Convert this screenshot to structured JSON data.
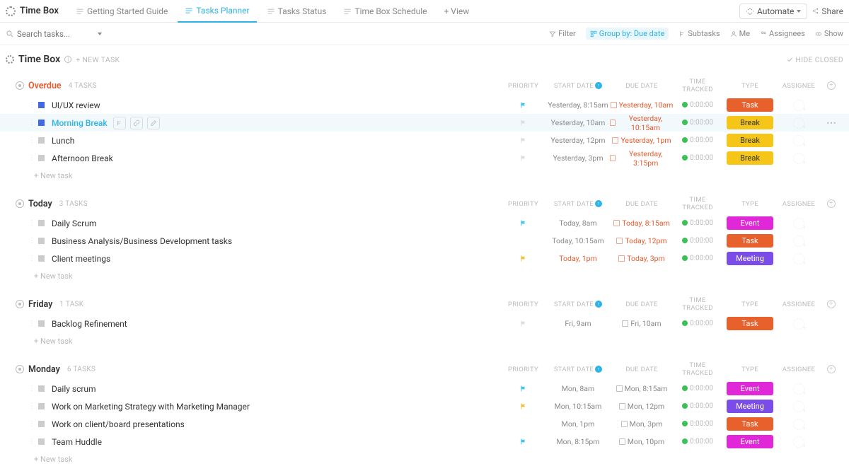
{
  "topbar": {
    "title": "Time Box",
    "tabs": [
      {
        "label": "Getting Started Guide"
      },
      {
        "label": "Tasks Planner",
        "active": true
      },
      {
        "label": "Tasks Status"
      },
      {
        "label": "Time Box Schedule"
      }
    ],
    "add_view": "+ View",
    "automate": "Automate",
    "share": "Share"
  },
  "filterbar": {
    "search_placeholder": "Search tasks...",
    "filter": "Filter",
    "group_by": "Group by: Due date",
    "subtasks": "Subtasks",
    "me": "Me",
    "assignees": "Assignees",
    "show": "Show"
  },
  "list_header": {
    "title": "Time Box",
    "new_task": "+ NEW TASK",
    "hide_closed": "HIDE CLOSED"
  },
  "column_headers": {
    "priority": "PRIORITY",
    "start_date": "START DATE",
    "due_date": "DUE DATE",
    "time_tracked": "TIME TRACKED",
    "type": "TYPE",
    "assignee": "ASSIGNEE"
  },
  "groups": [
    {
      "name": "Overdue",
      "overdue": true,
      "count": "4 TASKS",
      "tasks": [
        {
          "name": "UI/UX review",
          "status": "blue",
          "flag": "cyan",
          "start": "Yesterday, 8:15am",
          "due": "Yesterday, 10am",
          "due_red": true,
          "time": "0:00:00",
          "tag": "Task",
          "tag_cls": "tag-task"
        },
        {
          "name": "Morning Break",
          "status": "blue",
          "active": true,
          "hovered": true,
          "icons": true,
          "flag": "gray",
          "start": "Yesterday, 10am",
          "due": "Yesterday, 10:15am",
          "due_red": true,
          "time": "0:00:00",
          "tag": "Break",
          "tag_cls": "tag-break",
          "more": true
        },
        {
          "name": "Lunch",
          "status": "gray",
          "flag": "gray",
          "start": "Yesterday, 12pm",
          "due": "Yesterday, 1pm",
          "due_red": true,
          "time": "0:00:00",
          "tag": "Break",
          "tag_cls": "tag-break"
        },
        {
          "name": "Afternoon Break",
          "status": "gray",
          "flag": "gray",
          "start": "Yesterday, 3pm",
          "due": "Yesterday, 3:15pm",
          "due_red": true,
          "time": "0:00:00",
          "tag": "Break",
          "tag_cls": "tag-break"
        }
      ]
    },
    {
      "name": "Today",
      "count": "3 TASKS",
      "tasks": [
        {
          "name": "Daily Scrum",
          "status": "gray",
          "flag": "cyan",
          "start": "Today, 8am",
          "due": "Today, 8:15am",
          "due_red": true,
          "time": "0:00:00",
          "tag": "Event",
          "tag_cls": "tag-event"
        },
        {
          "name": "Business Analysis/Business Development tasks",
          "status": "gray",
          "flag": "",
          "start": "Today, 10:15am",
          "due": "Today, 12pm",
          "due_red": true,
          "time": "0:00:00",
          "tag": "Task",
          "tag_cls": "tag-task"
        },
        {
          "name": "Client meetings",
          "status": "gray",
          "flag": "yellow",
          "start": "Today, 1pm",
          "start_red": true,
          "due": "Today, 3pm",
          "due_red": true,
          "time": "0:00:00",
          "tag": "Meeting",
          "tag_cls": "tag-meeting"
        }
      ]
    },
    {
      "name": "Friday",
      "count": "1 TASK",
      "tasks": [
        {
          "name": "Backlog Refinement",
          "status": "gray",
          "flag": "gray",
          "start": "Fri, 9am",
          "due": "Fri, 10am",
          "time": "0:00:00",
          "tag": "Task",
          "tag_cls": "tag-task"
        }
      ]
    },
    {
      "name": "Monday",
      "count": "6 TASKS",
      "tasks": [
        {
          "name": "Daily scrum",
          "status": "gray",
          "flag": "cyan",
          "start": "Mon, 8am",
          "due": "Mon, 8:15am",
          "time": "0:00:00",
          "tag": "Event",
          "tag_cls": "tag-event"
        },
        {
          "name": "Work on Marketing Strategy with Marketing Manager",
          "status": "gray",
          "flag": "yellow",
          "start": "Mon, 10:15am",
          "due": "Mon, 12pm",
          "time": "0:00:00",
          "tag": "Meeting",
          "tag_cls": "tag-meeting"
        },
        {
          "name": "Work on client/board presentations",
          "status": "gray",
          "flag": "",
          "start": "Mon, 1pm",
          "due": "Mon, 3pm",
          "time": "0:00:00",
          "tag": "Task",
          "tag_cls": "tag-task"
        },
        {
          "name": "Team Huddle",
          "status": "gray",
          "flag": "cyan",
          "start": "Mon, 8:15pm",
          "due": "Mon, 10pm",
          "time": "0:00:00",
          "tag": "Event",
          "tag_cls": "tag-event"
        }
      ]
    }
  ],
  "new_task_row": "+ New task"
}
